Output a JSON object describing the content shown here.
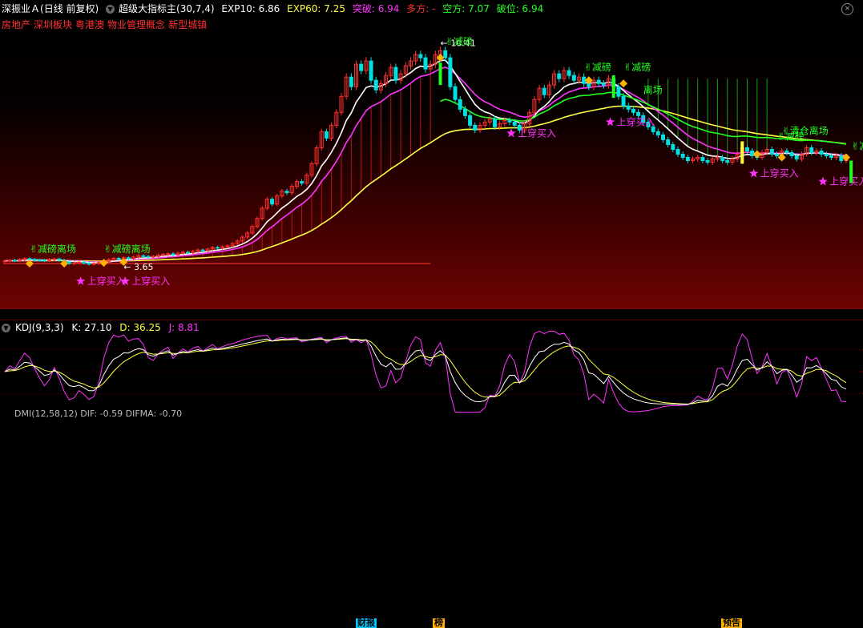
{
  "header": {
    "stock": "深振业Ａ",
    "period": "(日线 前复权)",
    "indicator": "超级大指标主(30,7,4)",
    "exp10_label": "EXP10: 6.86",
    "exp60_label": "EXP60: 7.25",
    "break_label": "突破: 6.94",
    "long_label": "多方: -",
    "short_label": "空方: 7.07",
    "break_down_label": "破位: 6.94",
    "close_glyph": "×"
  },
  "concepts": [
    "房地产",
    "深圳板块",
    "粤港澳",
    "物业管理概念",
    "新型城镇"
  ],
  "annotations": {
    "high_price": "10.41",
    "low_price": "3.65",
    "zhang": "减磅",
    "lixian": "离场",
    "buy": "上穿买入",
    "jianli": "减磅离场",
    "qingcang": "清仓离场"
  },
  "events": [
    "财报",
    "榜",
    "预告"
  ],
  "kdj": {
    "name": "KDJ(9,3,3)",
    "k_label": "K: 27.10",
    "d_label": "D: 36.25",
    "j_label": "J: 8.81"
  },
  "dmi": {
    "label": "DMI(12,58,12)  DIF: -0.59  DIFMA: -0.70"
  },
  "colors": {
    "up": "#ff3030",
    "down": "#00e0e0",
    "exp10": "#ffffff",
    "pink": "#ff33ff",
    "exp60": "#ffff40",
    "green": "#20ff20",
    "kdj_k": "#ffffff",
    "kdj_d": "#ffff40",
    "kdj_j": "#ff33ff"
  },
  "chart_data": {
    "type": "candlestick",
    "closes": [
      3.78,
      3.8,
      3.79,
      3.82,
      3.85,
      3.83,
      3.81,
      3.8,
      3.79,
      3.82,
      3.84,
      3.8,
      3.75,
      3.7,
      3.72,
      3.74,
      3.71,
      3.68,
      3.7,
      3.73,
      3.76,
      3.82,
      3.86,
      3.84,
      3.88,
      3.85,
      3.9,
      3.94,
      3.92,
      3.9,
      3.92,
      3.96,
      3.98,
      4.0,
      3.97,
      4.02,
      4.05,
      4.03,
      4.08,
      4.12,
      4.1,
      4.15,
      4.2,
      4.18,
      4.22,
      4.25,
      4.32,
      4.4,
      4.52,
      4.65,
      4.85,
      5.1,
      5.42,
      5.7,
      5.55,
      5.8,
      5.95,
      5.9,
      6.1,
      6.25,
      6.2,
      6.45,
      6.8,
      7.3,
      7.8,
      7.6,
      8.0,
      8.4,
      8.9,
      9.5,
      9.2,
      9.9,
      9.7,
      10.0,
      9.4,
      9.1,
      9.3,
      9.55,
      9.8,
      9.4,
      9.6,
      9.85,
      10.0,
      10.2,
      10.1,
      9.75,
      9.9,
      10.2,
      10.32,
      10.1,
      9.2,
      8.8,
      8.5,
      8.3,
      8.0,
      7.85,
      8.0,
      8.1,
      8.2,
      7.95,
      8.05,
      8.15,
      8.1,
      8.0,
      7.85,
      8.05,
      8.4,
      8.8,
      9.15,
      8.95,
      9.25,
      9.6,
      9.45,
      9.7,
      9.55,
      9.4,
      9.5,
      9.3,
      9.2,
      9.4,
      9.3,
      9.25,
      9.45,
      9.2,
      8.9,
      8.6,
      8.5,
      8.4,
      8.3,
      8.1,
      7.95,
      7.8,
      7.7,
      7.55,
      7.4,
      7.25,
      7.1,
      7.0,
      6.9,
      6.95,
      7.0,
      6.9,
      6.85,
      6.95,
      7.0,
      6.9,
      6.85,
      6.95,
      7.1,
      7.3,
      7.2,
      7.05,
      7.0,
      7.15,
      7.25,
      7.1,
      7.05,
      7.2,
      7.15,
      7.05,
      6.95,
      7.1,
      7.3,
      7.15,
      7.2,
      7.1,
      7.05,
      7.0,
      7.05,
      6.9,
      6.94
    ]
  }
}
